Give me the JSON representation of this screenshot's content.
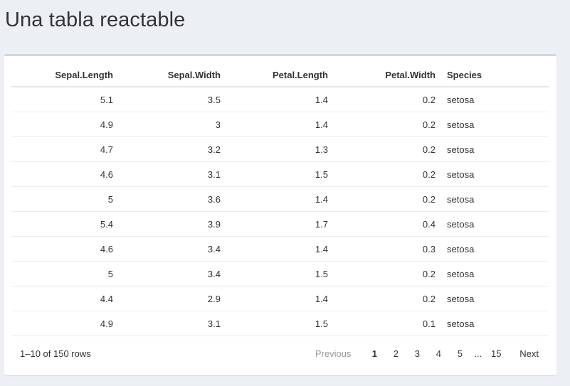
{
  "page": {
    "title": "Una tabla reactable"
  },
  "table": {
    "columns": [
      "Sepal.Length",
      "Sepal.Width",
      "Petal.Length",
      "Petal.Width",
      "Species"
    ],
    "rows": [
      [
        "5.1",
        "3.5",
        "1.4",
        "0.2",
        "setosa"
      ],
      [
        "4.9",
        "3",
        "1.4",
        "0.2",
        "setosa"
      ],
      [
        "4.7",
        "3.2",
        "1.3",
        "0.2",
        "setosa"
      ],
      [
        "4.6",
        "3.1",
        "1.5",
        "0.2",
        "setosa"
      ],
      [
        "5",
        "3.6",
        "1.4",
        "0.2",
        "setosa"
      ],
      [
        "5.4",
        "3.9",
        "1.7",
        "0.4",
        "setosa"
      ],
      [
        "4.6",
        "3.4",
        "1.4",
        "0.3",
        "setosa"
      ],
      [
        "5",
        "3.4",
        "1.5",
        "0.2",
        "setosa"
      ],
      [
        "4.4",
        "2.9",
        "1.4",
        "0.2",
        "setosa"
      ],
      [
        "4.9",
        "3.1",
        "1.5",
        "0.1",
        "setosa"
      ]
    ]
  },
  "pagination": {
    "info": "1–10 of 150 rows",
    "previous": "Previous",
    "next": "Next",
    "pages": [
      "1",
      "2",
      "3",
      "4",
      "5"
    ],
    "ellipsis": "...",
    "last_page": "15",
    "current_page": "1"
  }
}
